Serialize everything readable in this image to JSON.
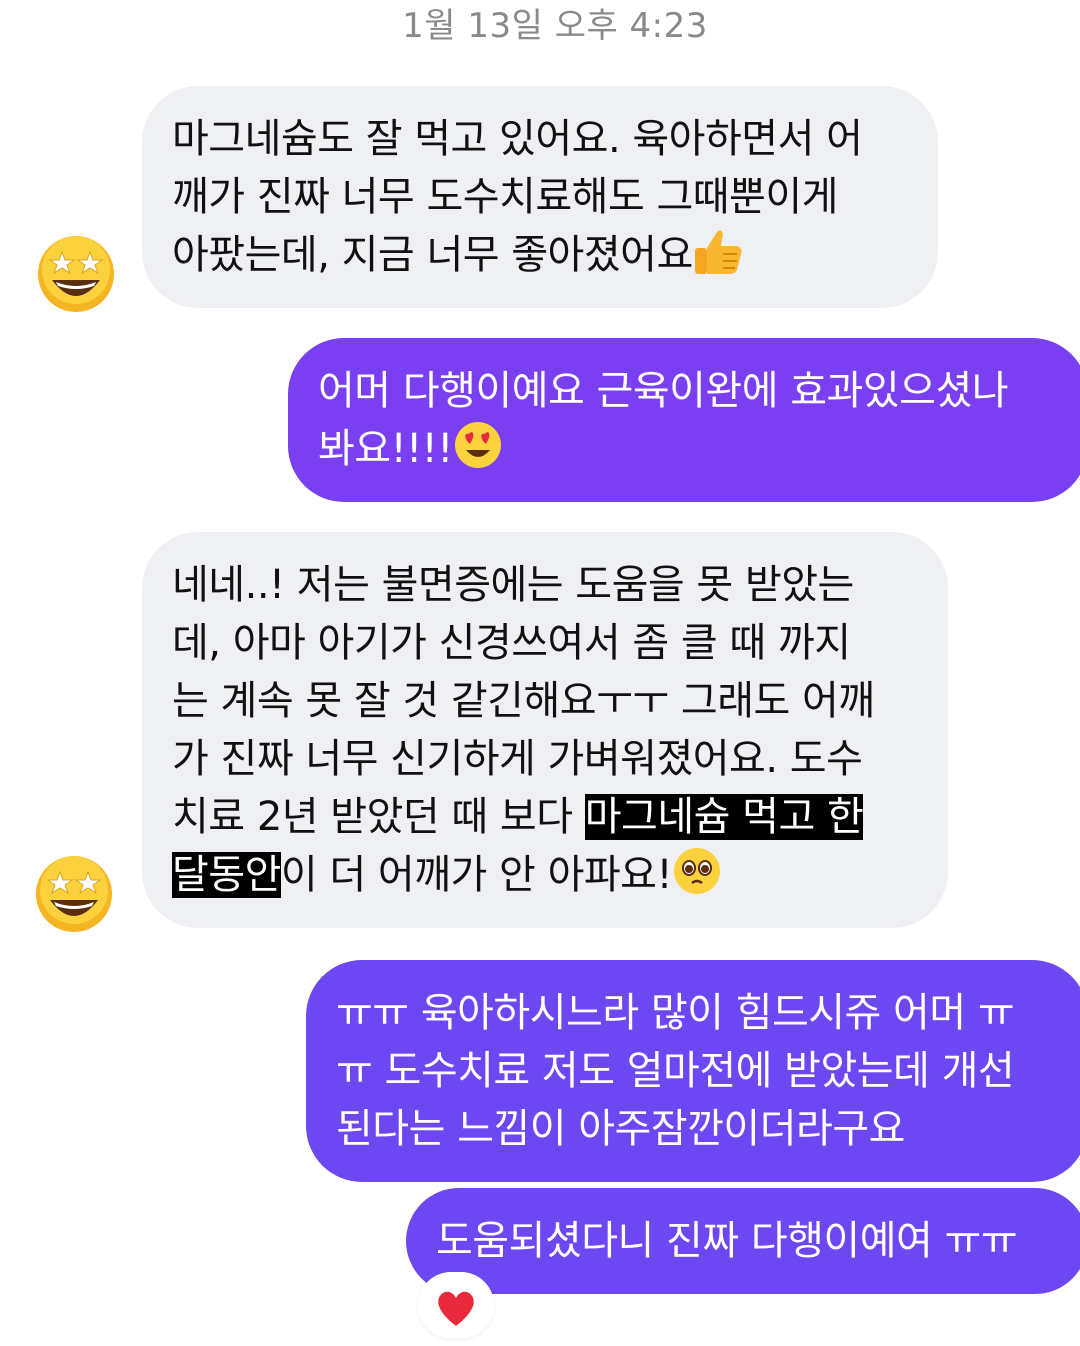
{
  "thread": {
    "timestamp": "1월 13일 오후 4:23"
  },
  "messages": [
    {
      "direction": "incoming",
      "lines": [
        "마그네슘도 잘 먹고 있어요. 육아하면서 어",
        "깨가 진짜 너무 도수치료해도 그때뿐이게",
        "아팠는데, 지금 너무 좋아졌어요"
      ],
      "trailing_emoji": "thumbs-up-emoji",
      "avatar_emoji": "star-struck-emoji"
    },
    {
      "direction": "outgoing",
      "lines": [
        "어머 다행이예요 근육이완에 효과있으셨나",
        "봐요!!!!"
      ],
      "trailing_emoji": "heart-eyes-emoji"
    },
    {
      "direction": "incoming",
      "lines": [
        "네네..! 저는 불면증에는 도움을 못 받았는",
        "데, 아마 아기가 신경쓰여서 좀 클 때 까지",
        "는 계속 못 잘 것 같긴해요ㅜㅜ 그래도 어깨",
        "가 진짜 너무 신기하게 가벼워졌어요. 도수",
        "치료 2년 받았던 때 보다 ",
        "마그네슘 먹고 한",
        "달동안",
        "이 더 어깨가 안 아파요!"
      ],
      "highlighted_phrase": "마그네슘 먹고 한 달동안",
      "trailing_emoji": "pleading-face-emoji",
      "avatar_emoji": "star-struck-emoji"
    },
    {
      "direction": "outgoing",
      "lines": [
        "ㅠㅠ 육아하시느라 많이 힘드시쥬 어머 ㅠ",
        "ㅠ 도수치료 저도 얼마전에 받았는데 개선",
        "된다는 느낌이 아주잠깐이더라구요"
      ]
    },
    {
      "direction": "outgoing",
      "lines": [
        "도움되셨다니 진짜 다행이예여 ㅠㅠ"
      ],
      "reaction": "red-heart-emoji"
    }
  ],
  "colors": {
    "incoming_bubble": "#eff0f4",
    "outgoing_bubble": "#7a3ff1",
    "outgoing_bubble_alt": "#6c47f2",
    "highlight": "#000000",
    "timestamp_text": "#8a8a8e"
  }
}
